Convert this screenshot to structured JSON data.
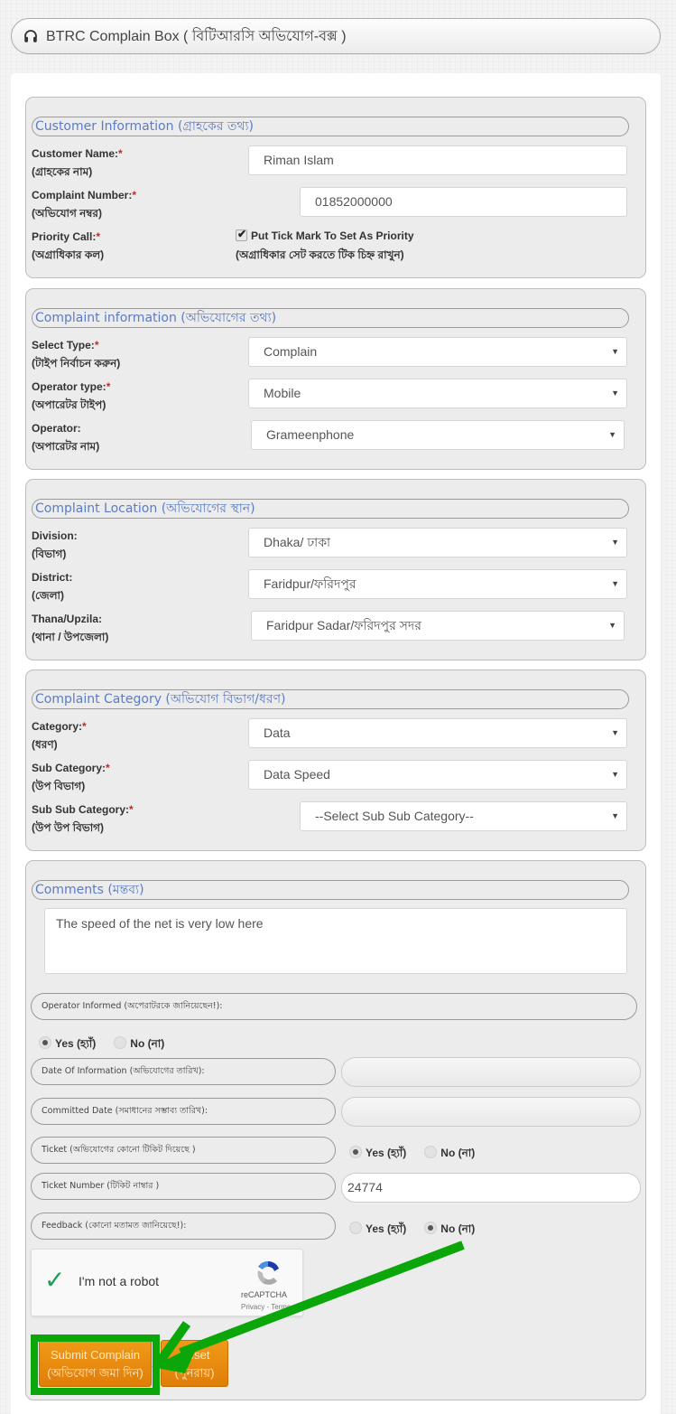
{
  "header": {
    "icon": "headset-icon",
    "title": "BTRC Complain Box ( বিটিআরসি অভিযোগ-বক্স )"
  },
  "customer_info": {
    "legend": "Customer Information (গ্রাহকের তথ্য)",
    "name_label": "Customer Name:",
    "name_label_bn": "(গ্রাহকের নাম)",
    "name_value": "Riman Islam",
    "number_label": "Complaint Number:",
    "number_label_bn": "(অভিযোগ নম্বর)",
    "number_value": "01852000000",
    "priority_label": "Priority Call:",
    "priority_label_bn": "(অগ্রাধিকার কল)",
    "priority_checked": true,
    "priority_text": "Put Tick Mark To Set As Priority",
    "priority_text_bn": "(অগ্রাধিকার সেট করতে টিক চিহ্ন রাখুন)",
    "required_mark": "*"
  },
  "complaint_info": {
    "legend": "Complaint information (অভিযোগের তথ্য)",
    "type_label": "Select Type:",
    "type_label_bn": "(টাইপ নির্বাচন করুন)",
    "type_value": "Complain",
    "operator_type_label": "Operator type:",
    "operator_type_label_bn": "(অপারেটর টাইপ)",
    "operator_type_value": "Mobile",
    "operator_label": "Operator:",
    "operator_label_bn": "(অপারেটর নাম)",
    "operator_value": "Grameenphone"
  },
  "location": {
    "legend": "Complaint Location (অভিযোগের স্থান)",
    "division_label": "Division:",
    "division_label_bn": "(বিভাগ)",
    "division_value": "Dhaka/ ঢাকা",
    "district_label": "District:",
    "district_label_bn": "(জেলা)",
    "district_value": "Faridpur/ফরিদপুর",
    "thana_label": "Thana/Upzila:",
    "thana_label_bn": "(থানা / উপজেলা)",
    "thana_value": "Faridpur Sadar/ফরিদপুর সদর"
  },
  "category": {
    "legend": "Complaint Category (অভিযোগ বিভাগ/ধরণ)",
    "category_label": "Category:",
    "category_label_bn": "(ধরণ)",
    "category_value": "Data",
    "sub_label": "Sub Category:",
    "sub_label_bn": "(উপ বিভাগ)",
    "sub_value": "Data Speed",
    "subsub_label": "Sub Sub Category:",
    "subsub_label_bn": "(উপ উপ বিভাগ)",
    "subsub_value": "--Select Sub Sub Category--"
  },
  "comments": {
    "legend": "Comments (মন্তব্য)",
    "text": "The speed of the net is very low here",
    "operator_informed_label": "Operator Informed (অপেরাটরকে জানিয়েছেন!):",
    "operator_informed": "yes",
    "yes_label": "Yes (হ্যাঁ)",
    "no_label": "No (না)",
    "date_info_label": "Date Of Information (অভিযোগের তারিখ):",
    "date_info_value": "",
    "committed_label": "Committed Date (সমাধানের সম্ভাব্য তারিখ):",
    "committed_value": "",
    "ticket_label": "Ticket (অভিযোগের কোনো টিকিট দিয়েছে )",
    "ticket": "yes",
    "ticket_number_label": "Ticket Number (টিকিট নাম্বার )",
    "ticket_number_value": "24774",
    "feedback_label": "Feedback (কোনো মতামত জানিয়েছে!):",
    "feedback": "no"
  },
  "recaptcha": {
    "label": "I'm not a robot",
    "brand": "reCAPTCHA",
    "terms": "Privacy - Terms",
    "checked": true
  },
  "actions": {
    "submit_label": "Submit Complain",
    "submit_label_bn": "(অভিযোগ জমা দিন)",
    "reset_label": "Reset",
    "reset_label_bn": "(পুনরায়)"
  },
  "annotation": {
    "color": "#0aa60a",
    "target": "submit-button"
  },
  "colors": {
    "legend_text": "#5b7cc4",
    "required": "#d42020",
    "button": "#f09a18"
  }
}
